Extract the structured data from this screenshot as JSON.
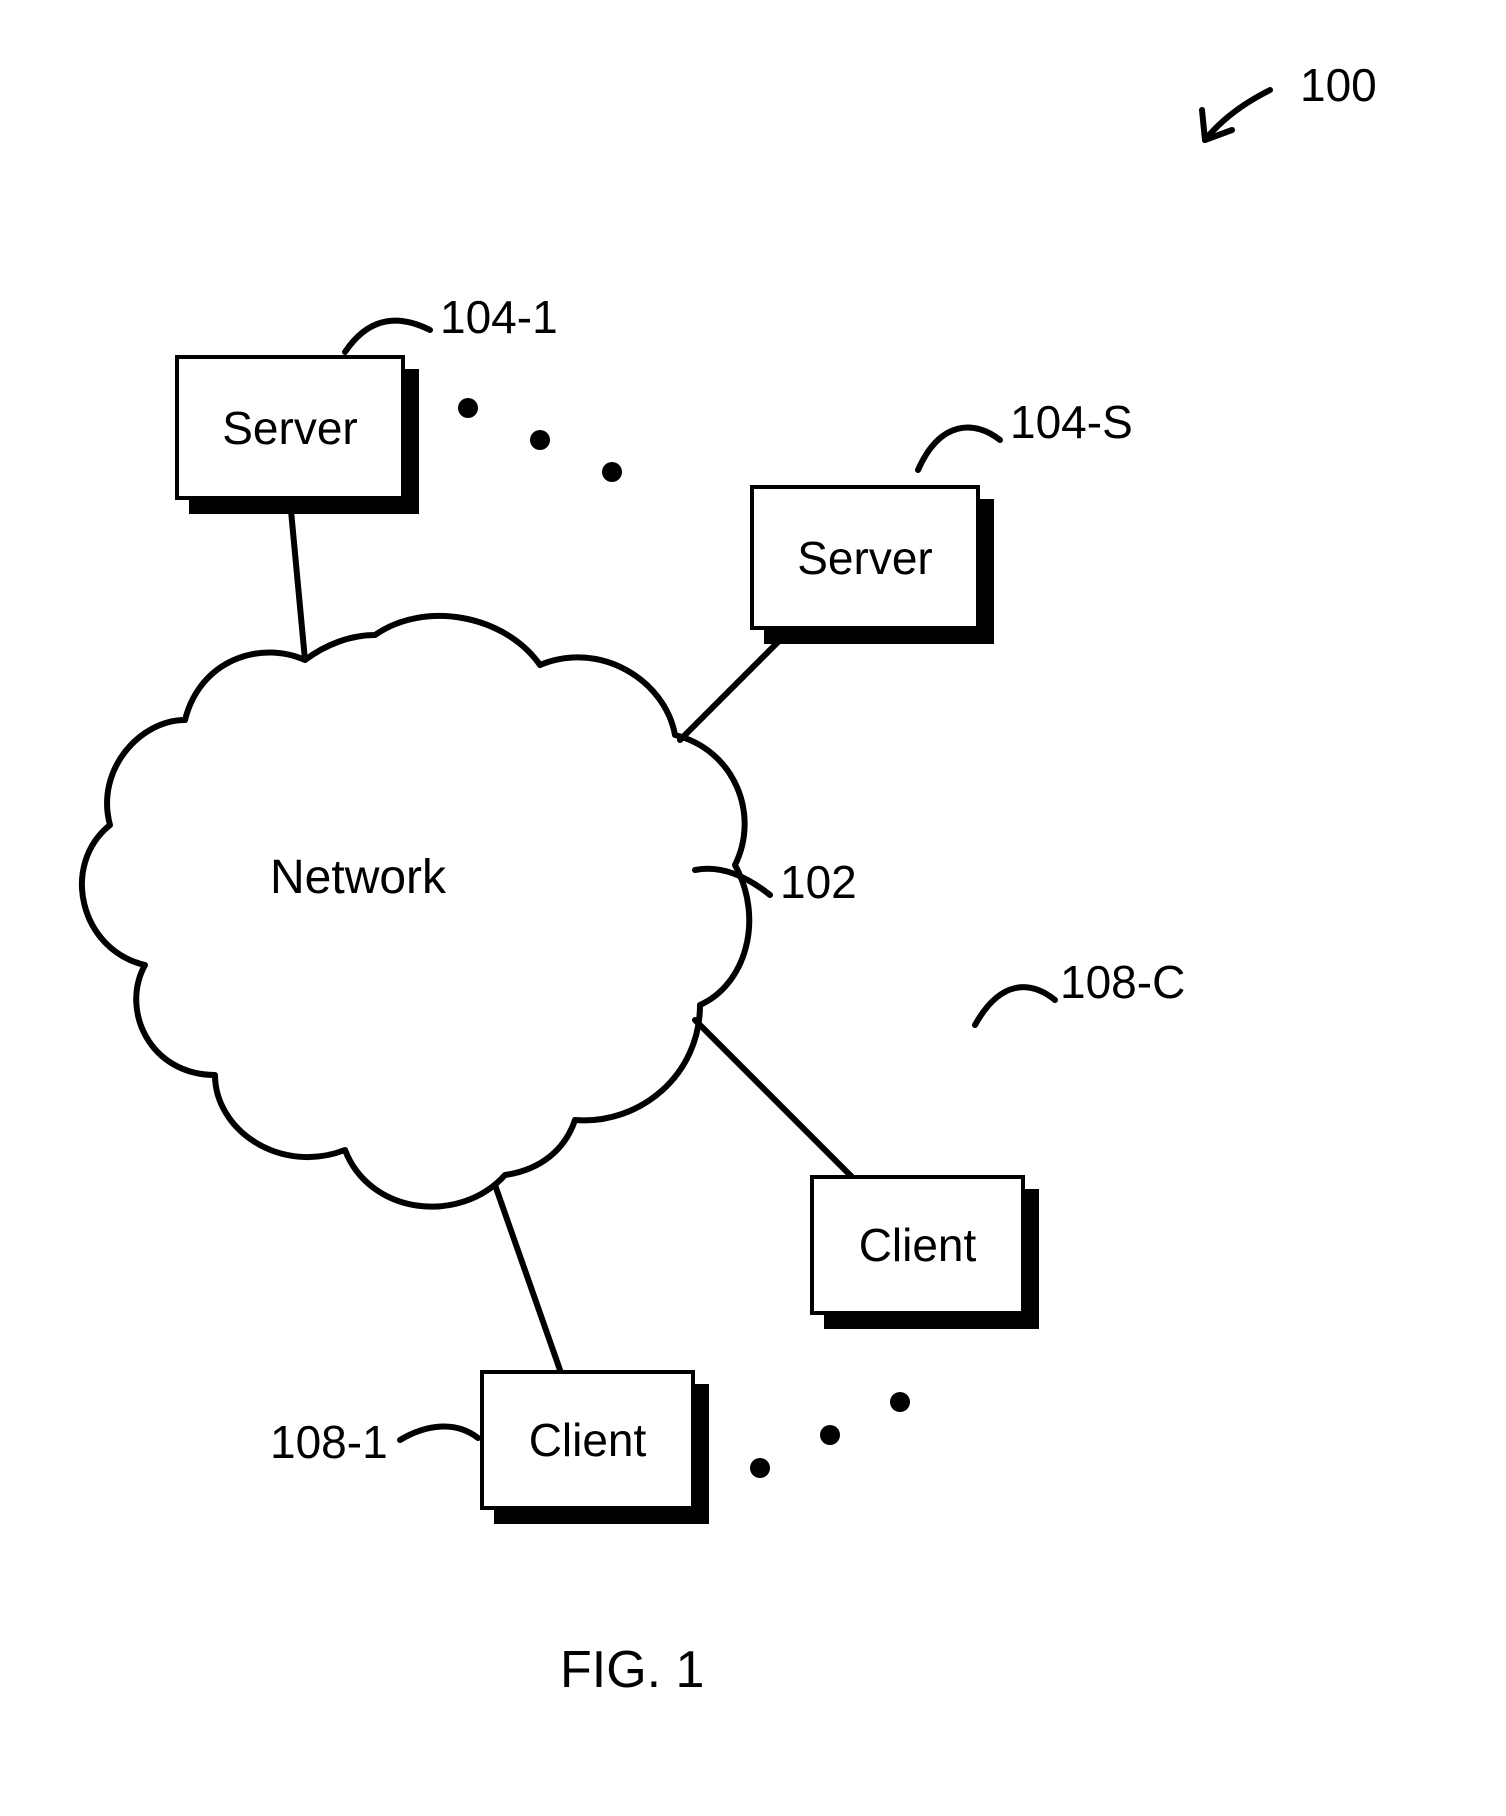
{
  "figure": {
    "overall_ref": "100",
    "caption": "FIG. 1"
  },
  "nodes": {
    "server1": {
      "text": "Server",
      "ref": "104-1"
    },
    "serverS": {
      "text": "Server",
      "ref": "104-S"
    },
    "network": {
      "text": "Network",
      "ref": "102"
    },
    "client1": {
      "text": "Client",
      "ref": "108-1"
    },
    "clientC": {
      "text": "Client",
      "ref": "108-C"
    }
  }
}
